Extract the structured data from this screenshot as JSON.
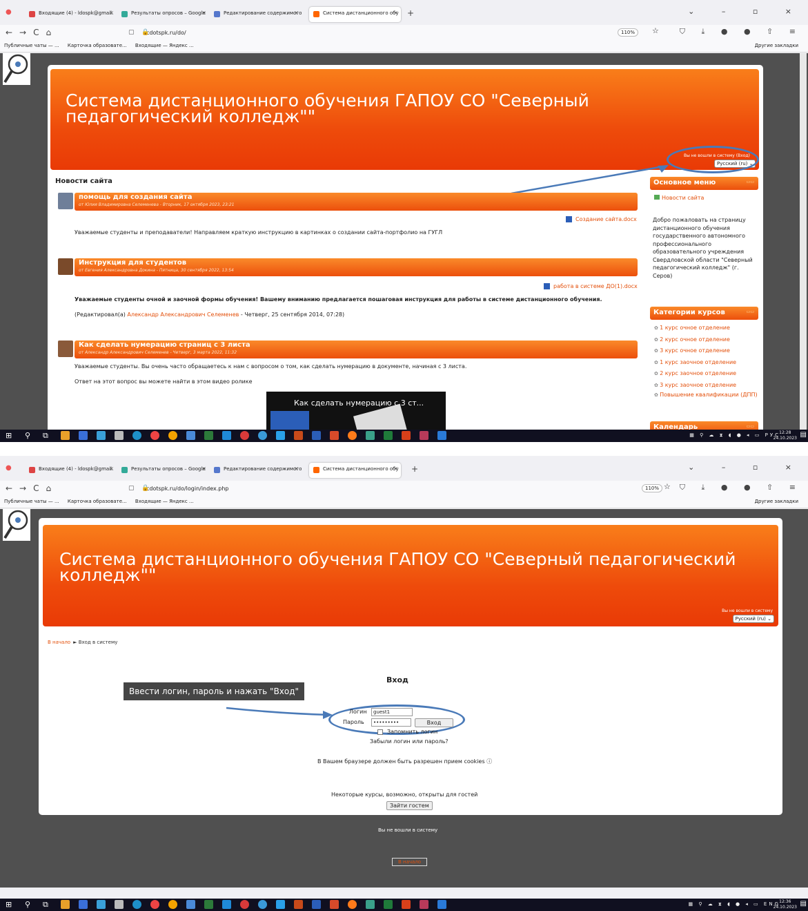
{
  "browser": {
    "tabs": [
      {
        "label": "Входящие (4) - ldospk@gmail.",
        "icon": "gmail-icon"
      },
      {
        "label": "Результаты опросов – Google",
        "icon": "google-drive-icon"
      },
      {
        "label": "Редактирование содержимого",
        "icon": "edit-icon"
      },
      {
        "label": "Система дистанционного обу",
        "icon": "moodle-icon"
      }
    ],
    "new_tab": "+",
    "zoom": "110%",
    "bookmarks": [
      "Публичные чаты — ...",
      "Карточка образовате...",
      "Входящие — Яндекс ..."
    ],
    "other_bookmarks": "Другие закладки"
  },
  "shot1": {
    "url": "cdotspk.ru/do/",
    "title": "Система дистанционного обучения ГАПОУ СО \"Северный педагогический колледж\"\"",
    "login_info": "Вы не вошли в систему (Вход)",
    "language": "Русский (ru) ⌄",
    "news_heading": "Новости сайта",
    "posts": [
      {
        "title": "помощь для создания сайта",
        "meta": "от Юлия Владимировна Селеменева - Вторник, 17 октября 2023, 23:21",
        "attachment": "Создание сайта.docx",
        "text": "Уважаемые студенты и преподаватели! Направляем краткую инструкцию в картинках о создании сайта-портфолио на ГУГЛ"
      },
      {
        "title": "Инструкция для студентов",
        "meta": "от Евгения Александровна Докина - Пятница, 30 сентября 2022, 13:54",
        "attachment": "работа в системе ДО(1).docx",
        "text": "Уважаемые студенты очной и  заочной формы обучения! Вашему вниманию предлагается пошаговая инструкция для работы в системе  дистанционного обучения.",
        "edited_prefix": "(Редактировал(а) ",
        "edited_author": "Александр Александрович Селеменев",
        "edited_suffix": " - Четверг, 25 сентября 2014, 07:28)"
      },
      {
        "title": "Как сделать нумерацию страниц с 3 листа",
        "meta": "от Александр Александрович Селеменев - Четверг, 3 марта 2022, 11:32",
        "text": "Уважаемые студенты. Вы очень часто обращаетесь к нам с вопросом о том, как сделать нумерацию в документе, начиная с 3 листа.",
        "text2": "Ответ на этот вопрос вы можете найти в этом видео ролике",
        "video_title": "Как сделать нумерацию с 3 ст..."
      }
    ],
    "main_menu": {
      "title": "Основное меню",
      "item": "Новости сайта",
      "welcome": "Добро пожаловать на страницу дистанционного обучения государственного автономного профессионального образовательного учреждения Свердловской области \"Северный педагогический колледж\" (г. Серов)"
    },
    "categories": {
      "title": "Категории курсов",
      "items": [
        "1 курс очное отделение",
        "2 курс очное отделение",
        "3 курс очное отделение",
        "1 курс заочное отделение",
        "2 курс заочное отделение",
        "3 курс заочное отделение",
        "Повышение квалификации (ДПП)"
      ]
    },
    "calendar": "Календарь",
    "clock_time": "12:28",
    "clock_date": "24.10.2023",
    "tray_lang": "РУС"
  },
  "shot2": {
    "url": "cdotspk.ru/do/login/index.php",
    "title": "Система дистанционного обучения ГАПОУ СО \"Северный педагогический колледж\"\"",
    "login_info": "Вы не вошли в систему",
    "language": "Русский (ru) ⌄",
    "breadcrumb_home": "В начало",
    "breadcrumb_sep": "►",
    "breadcrumb_current": "Вход в систему",
    "login_heading": "Вход",
    "hint": "Ввести логин, пароль и нажать \"Вход\"",
    "login_label": "Логин",
    "login_value": "guest1",
    "password_label": "Пароль",
    "password_value": "•••••••••",
    "login_button": "Вход",
    "remember": "Запомнить логин",
    "forgot": "Забыли логин или пароль?",
    "cookies": "В Вашем браузере должен быть разрешен прием cookies ⓘ",
    "guests_text": "Некоторые курсы, возможно, открыты для гостей",
    "guest_button": "Зайти гостем",
    "footer_text": "Вы не вошли в систему",
    "footer_home": "В начало",
    "clock_time": "12:36",
    "clock_date": "24.10.2023",
    "tray_lang": "ENG"
  },
  "colors": {
    "accent": "#e34f0a",
    "banner": "#f06214",
    "callout": "#4a7ab8",
    "page_bg": "#505050"
  }
}
